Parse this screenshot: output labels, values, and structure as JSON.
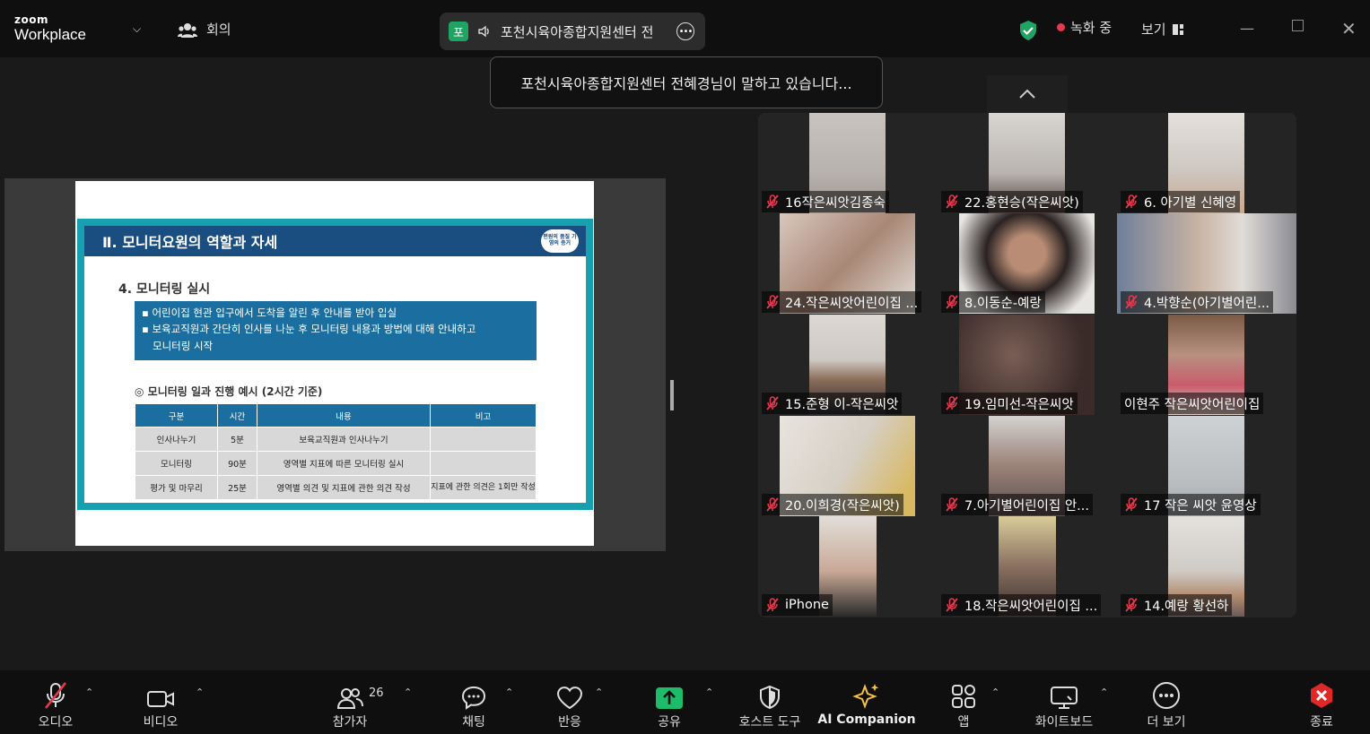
{
  "app": {
    "brand_small": "zoom",
    "brand_large": "Workplace"
  },
  "header": {
    "meeting_label": "회의",
    "speaker_avatar": "포",
    "speaker_name": "포천시육아종합지원센터 전",
    "recording_label": "녹화 중",
    "view_label": "보기"
  },
  "toast": {
    "text": "포천시육아종합지원센터 전혜경님이 말하고 있습니다..."
  },
  "slide": {
    "title": "Ⅱ. 모니터요원의 역할과 자세",
    "logo_text": "편원의 품질 가영의 증거",
    "heading": "4. 모니터링 실시",
    "bullets": [
      "▪  어린이집 현관 입구에서 도착을 알린 후 안내를 받아 입실",
      "▪  보육교직원과 간단히 인사를 나눈 후 모니터링 내용과 방법에 대해 안내하고",
      "    모니터링 시작"
    ],
    "note": "◎ 모니터링 일과 진행 예시 (2시간 기준)",
    "table": {
      "headers": [
        "구분",
        "시간",
        "내용",
        "비고"
      ],
      "rows": [
        [
          "인사나누기",
          "5분",
          "보육교직원과 인사나누기",
          ""
        ],
        [
          "모니터링",
          "90분",
          "영역별 지표에 따른 모니터링 실시",
          ""
        ],
        [
          "평가 및 마무리",
          "25분",
          "영역별 의견 및 지표에 관한 의견 작성",
          "지표에 관한 의견은 1회만 작성"
        ]
      ]
    }
  },
  "participants": [
    {
      "name": "16작은씨앗김종숙"
    },
    {
      "name": "22.홍현승(작은씨앗)"
    },
    {
      "name": "6. 아기별 신혜영"
    },
    {
      "name": "24.작은씨앗어린이집 ..."
    },
    {
      "name": "8.이동순-예랑"
    },
    {
      "name": "4.박향순(아기별어린..."
    },
    {
      "name": "15.준형 이-작은씨앗"
    },
    {
      "name": "19.임미선-작은씨앗"
    },
    {
      "name": "이현주 작은씨앗어린이집"
    },
    {
      "name": "20.이희경(작은씨앗)"
    },
    {
      "name": "7.아기별어린이집 안..."
    },
    {
      "name": "17 작은 씨앗 윤영상"
    },
    {
      "name": "iPhone"
    },
    {
      "name": "18.작은씨앗어린이집 ..."
    },
    {
      "name": "14.예랑 황선하"
    }
  ],
  "toolbar": {
    "audio": "오디오",
    "video": "비디오",
    "participants": "참가자",
    "participants_count": "26",
    "chat": "채팅",
    "reactions": "반응",
    "share": "공유",
    "host_tools": "호스트 도구",
    "ai": "AI Companion",
    "apps": "앱",
    "whiteboard": "화이트보드",
    "more": "더 보기",
    "end": "종료"
  },
  "colors": {
    "accent_green": "#1fa463",
    "share_green": "#1dbc6a",
    "end_red": "#e02828",
    "mic_red": "#e8384f",
    "ai_gold": "#f6c244"
  }
}
